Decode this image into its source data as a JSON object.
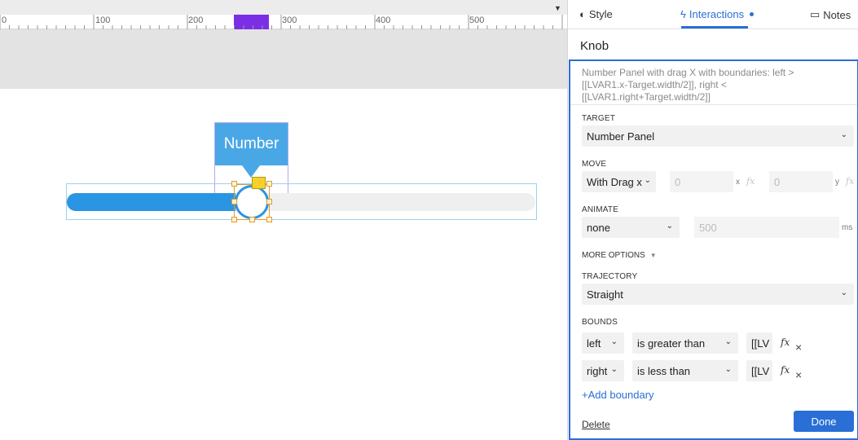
{
  "ruler": {
    "labels": [
      "0",
      "100",
      "200",
      "300",
      "400",
      "500"
    ],
    "dropdown_glyph": "▼"
  },
  "canvas": {
    "tooltip_text": "Number",
    "slider_value_fraction": 0.36,
    "badge_glyph": "⚡"
  },
  "tabs": {
    "style": {
      "label": "Style",
      "icon": "◐"
    },
    "interactions": {
      "label": "Interactions",
      "icon": "ϟ"
    },
    "notes": {
      "label": "Notes",
      "icon": "▭"
    }
  },
  "widget_name": "Knob",
  "interaction": {
    "description": "Number Panel with drag X  with boundaries: left > [[LVAR1.x-Target.width/2]], right < [[LVAR1.right+Target.width/2]]",
    "target": {
      "label": "TARGET",
      "value": "Number Panel"
    },
    "move": {
      "label": "MOVE",
      "mode": "With Drag x",
      "x_placeholder": "0",
      "x_suffix": "x",
      "y_placeholder": "0",
      "y_suffix": "y",
      "fx": "fx"
    },
    "animate": {
      "label": "ANIMATE",
      "easing": "none",
      "duration_placeholder": "500",
      "duration_suffix": "ms"
    },
    "more_options": "MORE OPTIONS",
    "trajectory": {
      "label": "TRAJECTORY",
      "value": "Straight"
    },
    "bounds": {
      "label": "BOUNDS",
      "rows": [
        {
          "side": "left",
          "operator": "is greater than",
          "value": "[[LV"
        },
        {
          "side": "right",
          "operator": "is less than",
          "value": "[[LV"
        }
      ]
    },
    "add_boundary": "+Add boundary",
    "delete": "Delete",
    "done": "Done"
  },
  "colors": {
    "accent": "#2a6fd6",
    "slider_blue": "#2a95e3",
    "tooltip_blue": "#49a7e6",
    "ruler_highlight": "#7b2ee6"
  }
}
